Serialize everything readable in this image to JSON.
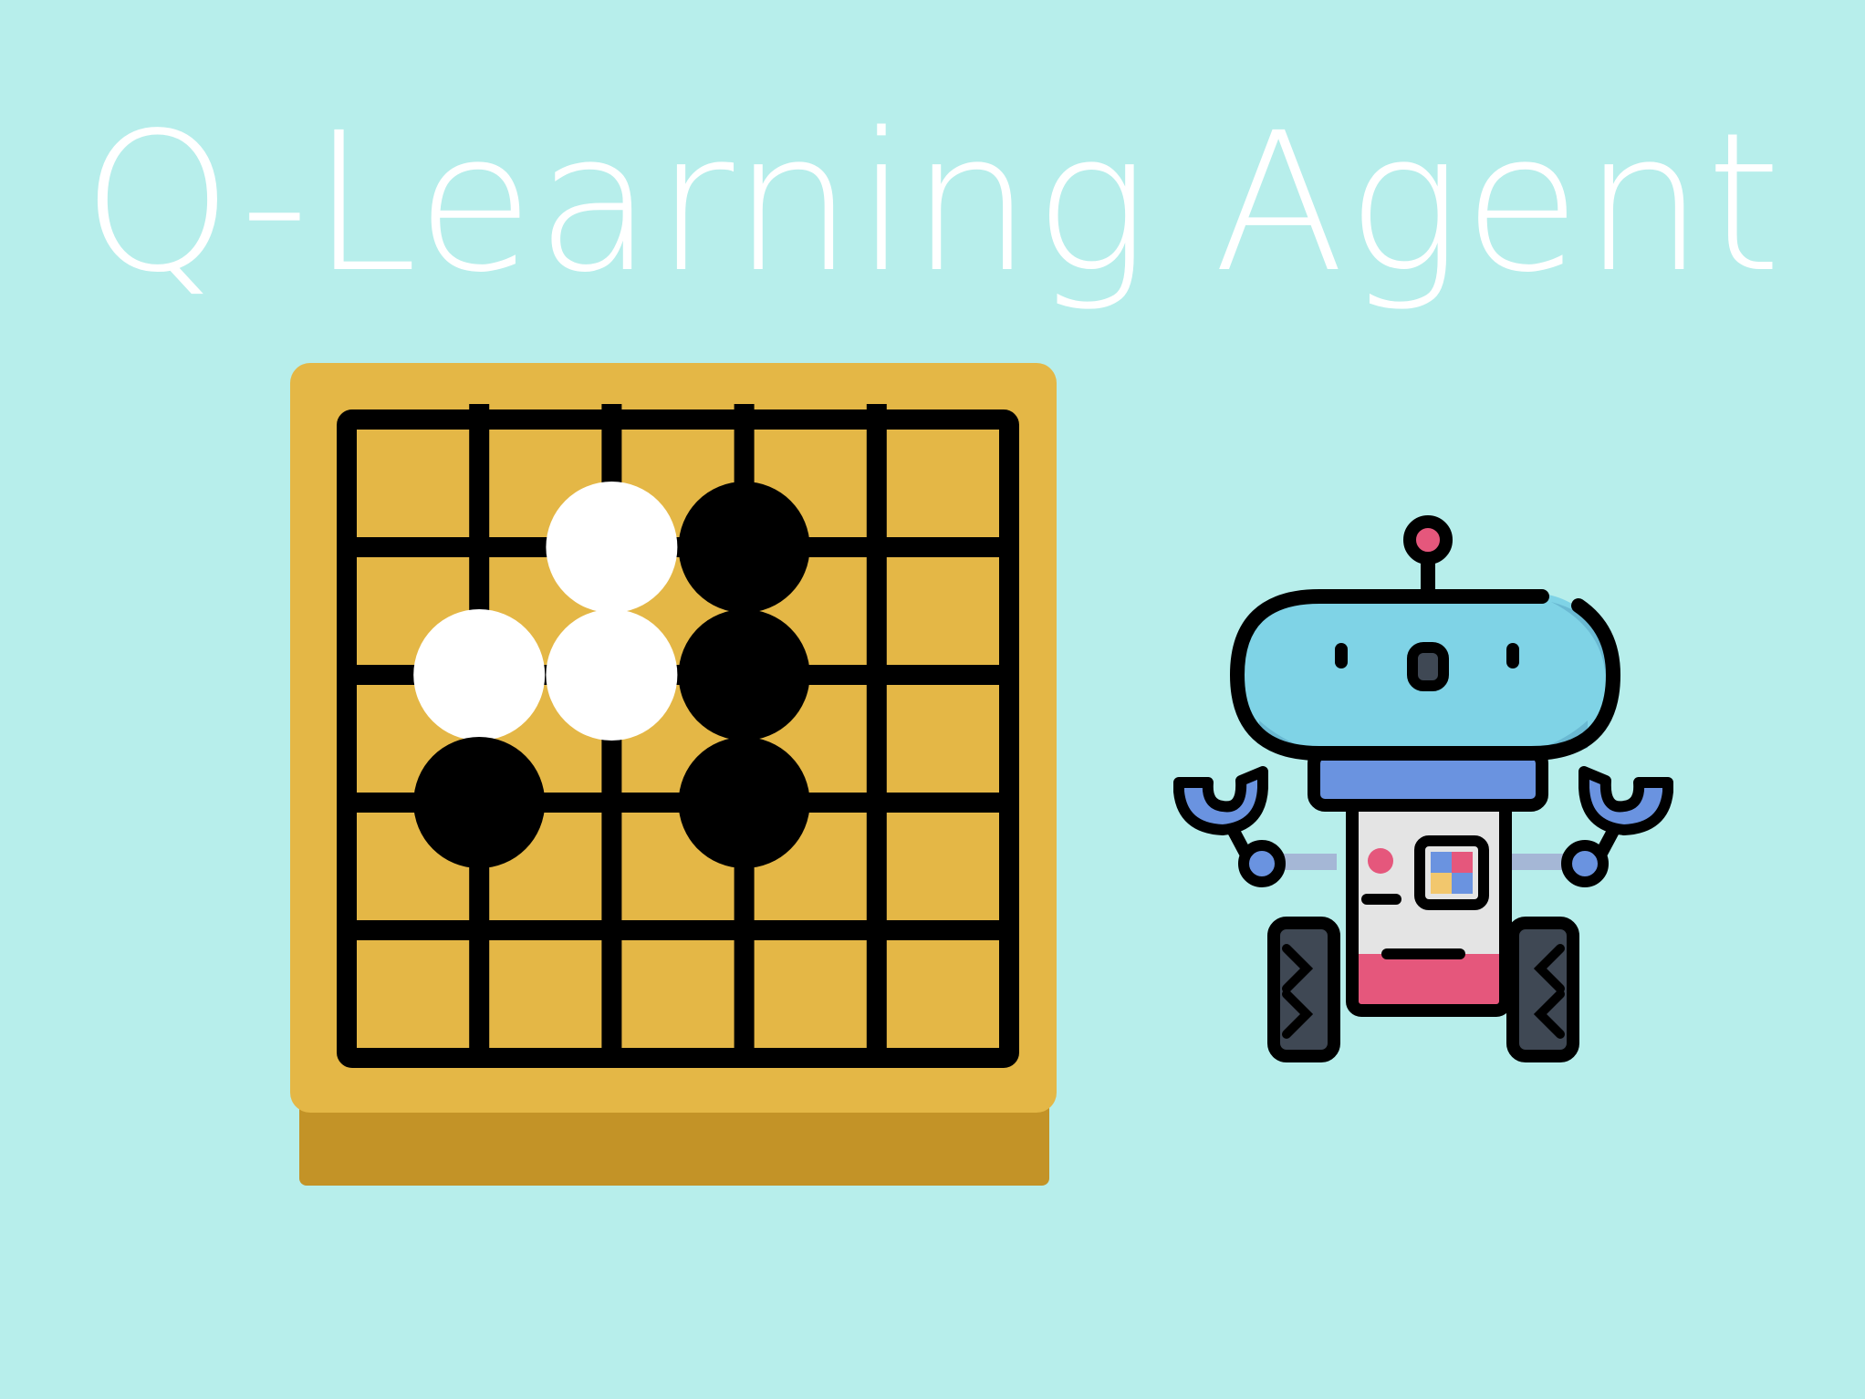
{
  "title": "Q-Learning Agent",
  "colors": {
    "background": "#b7eeeb",
    "title": "#ffffff",
    "board_face": "#e4b746",
    "board_side": "#c39327",
    "grid_line": "#000000",
    "stone_white": "#ffffff",
    "stone_black": "#000000",
    "robot_head": "#7fd3e6",
    "robot_collar": "#6a93e0",
    "robot_body": "#e4e4e4",
    "robot_accent": "#e5577c",
    "robot_wheel": "#3f4854"
  },
  "board": {
    "size": 5,
    "stones": [
      {
        "col": 2,
        "row": 1,
        "color": "white"
      },
      {
        "col": 3,
        "row": 1,
        "color": "black"
      },
      {
        "col": 1,
        "row": 2,
        "color": "white"
      },
      {
        "col": 2,
        "row": 2,
        "color": "white"
      },
      {
        "col": 3,
        "row": 2,
        "color": "black"
      },
      {
        "col": 1,
        "row": 3,
        "color": "black"
      },
      {
        "col": 3,
        "row": 3,
        "color": "black"
      }
    ]
  },
  "icons": {
    "board": "go-board-icon",
    "robot": "robot-icon"
  }
}
